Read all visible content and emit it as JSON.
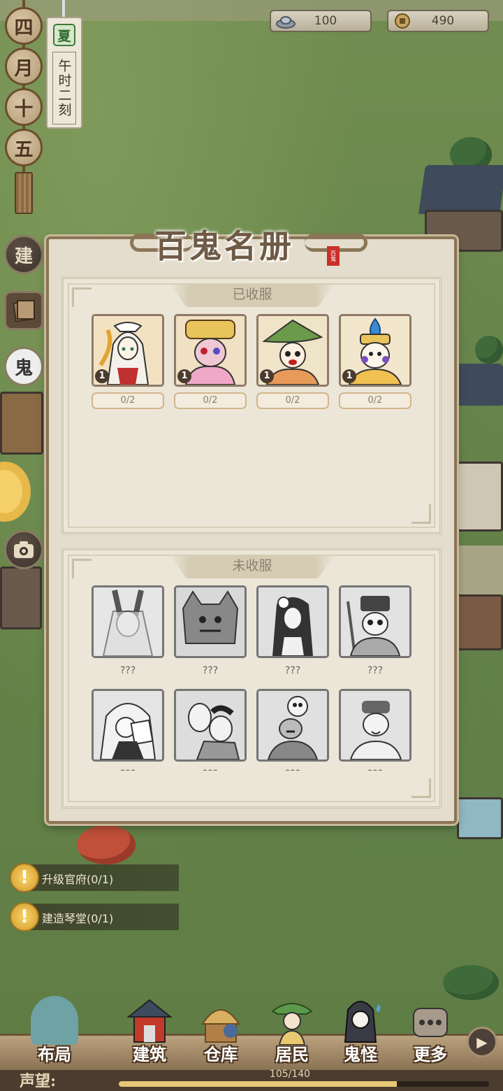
{
  "currency": {
    "silver": {
      "icon": "silver-ingot-icon",
      "value": "100"
    },
    "coin": {
      "icon": "copper-coin-icon",
      "value": "490"
    }
  },
  "calendar": {
    "date_chars": [
      "四",
      "月",
      "十",
      "五"
    ],
    "season": "夏",
    "time": "午时二刻"
  },
  "side_buttons": {
    "build": "建",
    "ghost": "鬼"
  },
  "book": {
    "title": "百鬼名册",
    "seal": "百鬼",
    "caught_header": "已收服",
    "uncaught_header": "未收服",
    "caught": [
      {
        "level": "1",
        "progress": "0/2"
      },
      {
        "level": "1",
        "progress": "0/2"
      },
      {
        "level": "1",
        "progress": "0/2"
      },
      {
        "level": "1",
        "progress": "0/2"
      }
    ],
    "uncaught_label": "???"
  },
  "quests": [
    {
      "icon": "exclamation-icon",
      "text": "升级官府(0/1)"
    },
    {
      "icon": "exclamation-icon",
      "text": "建造琴堂(0/1)"
    }
  ],
  "nav": {
    "items": [
      "布局",
      "建筑",
      "仓库",
      "居民",
      "鬼怪",
      "更多"
    ],
    "active": "布局"
  },
  "reputation": {
    "label": "声望:",
    "value_text": "105/140",
    "fraction": 0.75
  }
}
